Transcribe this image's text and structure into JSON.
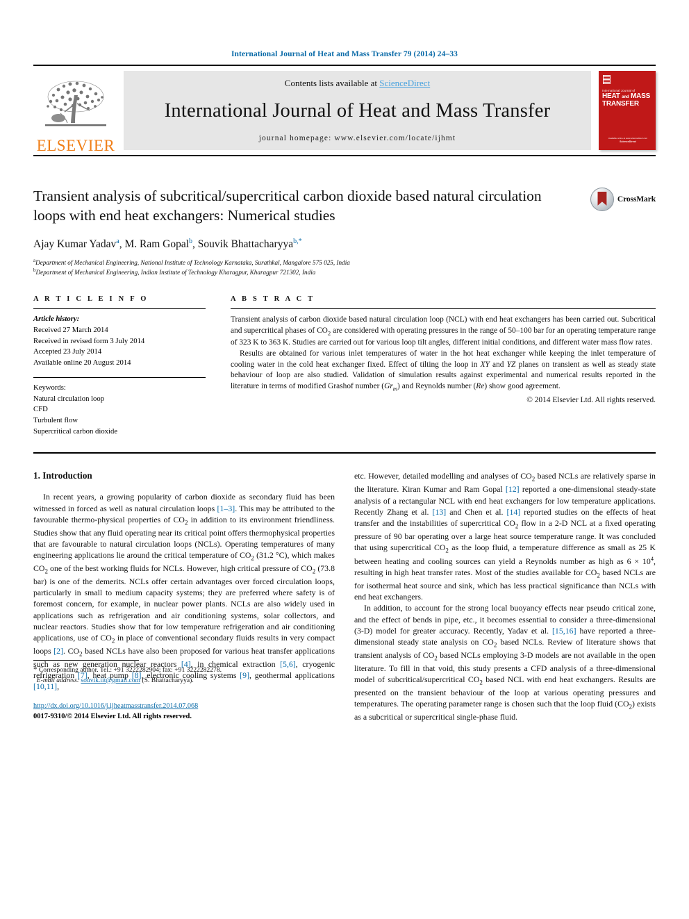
{
  "running_head": "International Journal of Heat and Mass Transfer 79 (2014) 24–33",
  "masthead": {
    "publisher_logo_text": "ELSEVIER",
    "contents_prefix": "Contents lists available at ",
    "contents_link": "ScienceDirect",
    "journal_title": "International Journal of Heat and Mass Transfer",
    "homepage_line": "journal homepage: www.elsevier.com/locate/ijhmt",
    "cover": {
      "small_line": "International Journal of",
      "title_1": "HEAT",
      "title_and": "and",
      "title_2": "MASS",
      "title_3": "TRANSFER",
      "foot_small": "Available online at www.sciencedirect.com",
      "foot_bold": "ScienceDirect"
    }
  },
  "title_block": {
    "title": "Transient analysis of subcritical/supercritical carbon dioxide based natural circulation loops with end heat exchangers: Numerical studies",
    "crossmark_label": "CrossMark",
    "authors": [
      {
        "name": "Ajay Kumar Yadav",
        "marks": "a"
      },
      {
        "name": "M. Ram Gopal",
        "marks": "b"
      },
      {
        "name": "Souvik Bhattacharyya",
        "marks": "b,*"
      }
    ],
    "affiliations": [
      {
        "mark": "a",
        "text": "Department of Mechanical Engineering, National Institute of Technology Karnataka, Surathkal, Mangalore 575 025, India"
      },
      {
        "mark": "b",
        "text": "Department of Mechanical Engineering, Indian Institute of Technology Kharagpur, Kharagpur 721302, India"
      }
    ]
  },
  "article_info": {
    "heading": "A R T I C L E    I N F O",
    "history_label": "Article history:",
    "history": [
      "Received 27 March 2014",
      "Received in revised form 3 July 2014",
      "Accepted 23 July 2014",
      "Available online 20 August 2014"
    ],
    "keywords_label": "Keywords:",
    "keywords": [
      "Natural circulation loop",
      "CFD",
      "Turbulent flow",
      "Supercritical carbon dioxide"
    ]
  },
  "abstract": {
    "heading": "A B S T R A C T",
    "para1_a": "Transient analysis of carbon dioxide based natural circulation loop (NCL) with end heat exchangers has been carried out. Subcritical and supercritical phases of CO",
    "para1_sub": "2",
    "para1_b": " are considered with operating pressures in the range of 50–100 bar for an operating temperature range of 323 K to 363 K. Studies are carried out for various loop tilt angles, different initial conditions, and different water mass flow rates.",
    "para2_a": "Results are obtained for various inlet temperatures of water in the hot heat exchanger while keeping the inlet temperature of cooling water in the cold heat exchanger fixed. Effect of tilting the loop in ",
    "para2_xy": "XY",
    "para2_b": " and ",
    "para2_yz": "YZ",
    "para2_c": " planes on transient as well as steady state behaviour of loop are also studied. Validation of simulation results against experimental and numerical results reported in the literature in terms of modified Grashof number (",
    "para2_gr": "Gr",
    "para2_gr_sub": "m",
    "para2_d": ") and Reynolds number (",
    "para2_re": "Re",
    "para2_e": ") show good agreement.",
    "copyright": "© 2014 Elsevier Ltd. All rights reserved."
  },
  "body": {
    "section_title": "1. Introduction",
    "left_paragraph_parts": {
      "p1_1": "In recent years, a growing popularity of carbon dioxide as secondary fluid has been witnessed in forced as well as natural circulation loops ",
      "r1": "[1–3]",
      "p1_2": ". This may be attributed to the favourable thermo-physical properties of CO",
      "s1": "2",
      "p1_3": " in addition to its environment friendliness. Studies show that any fluid operating near its critical point offers thermophysical properties that are favourable to natural circulation loops (NCLs). Operating temperatures of many engineering applications lie around the critical temperature of CO",
      "s2": "2",
      "p1_4": " (31.2 °C), which makes CO",
      "s3": "2",
      "p1_5": " one of the best working fluids for NCLs. However, high critical pressure of CO",
      "s4": "2",
      "p1_6": " (73.8 bar) is one of the demerits. NCLs offer certain advantages over forced circulation loops, particularly in small to medium capacity systems; they are preferred where safety is of foremost concern, for example, in nuclear power plants. NCLs are also widely used in applications such as refrigeration and air conditioning systems, solar collectors, and nuclear reactors. Studies show that for low temperature refrigeration and air conditioning applications, use of CO",
      "s5": "2",
      "p1_7": " in place of conventional secondary fluids results in very compact loops ",
      "r2": "[2]",
      "p1_8": ". CO",
      "s6": "2",
      "p1_9": " based NCLs have also been proposed for various heat transfer applications such as new generation nuclear reactors ",
      "r3": "[4]",
      "p1_10": ", in chemical extraction ",
      "r4": "[5,6]",
      "p1_11": ", cryogenic refrigeration ",
      "r5": "[7]",
      "p1_12": ", heat pump ",
      "r6": "[8]",
      "p1_13": ", electronic cooling systems ",
      "r7": "[9]",
      "p1_14": ", geothermal applications ",
      "r8": "[10,11]",
      "p1_15": ","
    },
    "right_paragraph_parts": {
      "p2_1": "etc. However, detailed modelling and analyses of CO",
      "s1": "2",
      "p2_2": " based NCLs are relatively sparse in the literature. Kiran Kumar and Ram Gopal ",
      "r1": "[12]",
      "p2_3": " reported a one-dimensional steady-state analysis of a rectangular NCL with end heat exchangers for low temperature applications. Recently Zhang et al. ",
      "r2": "[13]",
      "p2_4": " and Chen et al. ",
      "r3": "[14]",
      "p2_5": " reported studies on the effects of heat transfer and the instabilities of supercritical CO",
      "s2": "2",
      "p2_6": " flow in a 2-D NCL at a fixed operating pressure of 90 bar operating over a large heat source temperature range. It was concluded that using supercritical CO",
      "s3": "2",
      "p2_7": " as the loop fluid, a temperature difference as small as 25 K between heating and cooling sources can yield a Reynolds number as high as 6 × 10",
      "sup1": "4",
      "p2_8": ", resulting in high heat transfer rates. Most of the studies available for CO",
      "s4": "2",
      "p2_9": " based NCLs are for isothermal heat source and sink, which has less practical significance than NCLs with end heat exchangers.",
      "p3_1": "In addition, to account for the strong local buoyancy effects near pseudo critical zone, and the effect of bends in pipe, etc., it becomes essential to consider a three-dimensional (3-D) model for greater accuracy. Recently, Yadav et al. ",
      "r4": "[15,16]",
      "p3_2": " have reported a three-dimensional steady state analysis on CO",
      "s5": "2",
      "p3_3": " based NCLs. Review of literature shows that transient analysis of CO",
      "s6": "2",
      "p3_4": " based NCLs employing 3-D models are not available in the open literature. To fill in that void, this study presents a CFD analysis of a three-dimensional model of subcritical/supercritical CO",
      "s7": "2",
      "p3_5": " based NCL with end heat exchangers. Results are presented on the transient behaviour of the loop at various operating pressures and temperatures. The operating parameter range is chosen such that the loop fluid (CO",
      "s8": "2",
      "p3_6": ") exists as a subcritical or supercritical single-phase fluid."
    }
  },
  "footnote": {
    "star": "*",
    "corresponding": " Corresponding author. Tel.: +91 3222282904; fax: +91 3222282278.",
    "email_label": "E-mail address:",
    "email": "souvik.iit@gmail.com",
    "email_suffix": " (S. Bhattacharyya).",
    "doi": "http://dx.doi.org/10.1016/j.ijheatmasstransfer.2014.07.068",
    "issn_a": "0017-9310/",
    "issn_copy": "© ",
    "issn_b": "2014 Elsevier Ltd. All rights reserved."
  },
  "colors": {
    "link": "#0b6ba8",
    "elsevier_orange": "#f07f18",
    "cover_red": "#c01818",
    "sciencedirect": "#4aa3df"
  }
}
